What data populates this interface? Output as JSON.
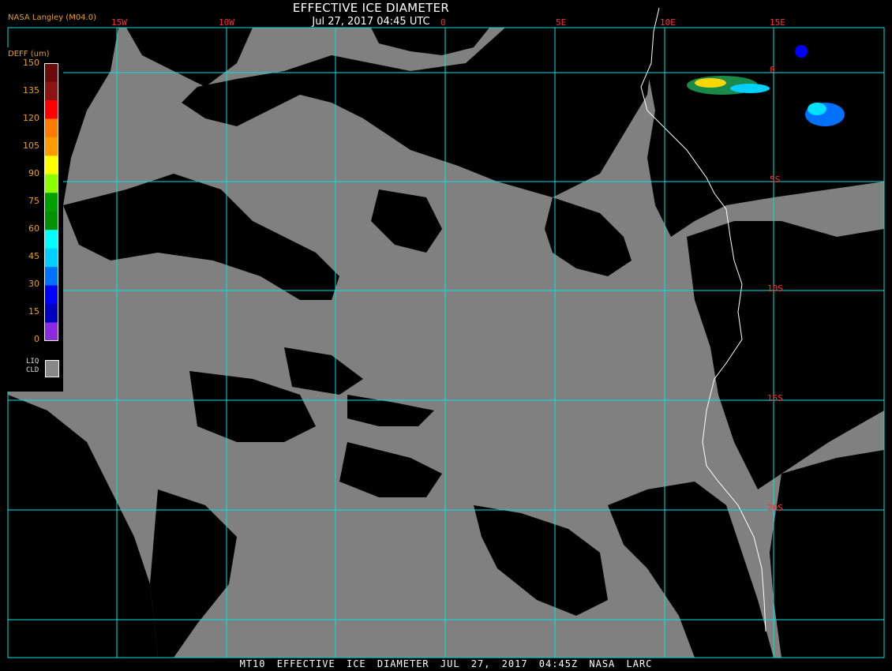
{
  "header": {
    "agency": "NASA Langley (M04.0)",
    "title": "EFFECTIVE ICE DIAMETER",
    "subtitle": "Jul 27, 2017 04:45 UTC"
  },
  "legend": {
    "title": "DEFF (um)",
    "ticks": [
      "150",
      "135",
      "120",
      "105",
      "90",
      "75",
      "60",
      "45",
      "30",
      "15",
      "0"
    ],
    "colors": [
      "#6b0a0a",
      "#8b1414",
      "#ff0000",
      "#ff7a00",
      "#ff9a00",
      "#ffff00",
      "#8cff00",
      "#00a000",
      "#009000",
      "#00ffff",
      "#00cfff",
      "#0070ff",
      "#0000ff",
      "#0000c0",
      "#8a2be2"
    ],
    "liquid_label_1": "LIQ",
    "liquid_label_2": "CLD",
    "liquid_color": "#888888"
  },
  "axes": {
    "longitude_labels": [
      "15W",
      "10W",
      "0",
      "5E",
      "10E",
      "15E"
    ],
    "latitude_labels": [
      "0",
      "5S",
      "10S",
      "15S",
      "20S"
    ]
  },
  "colors": {
    "cloud": "#808080",
    "clear": "#000000",
    "grid": "#00e5e5",
    "coast": "#ffffff"
  },
  "footer": {
    "text": "MT10  EFFECTIVE ICE DIAMETER  JUL 27, 2017 04:45Z  NASA LARC"
  }
}
